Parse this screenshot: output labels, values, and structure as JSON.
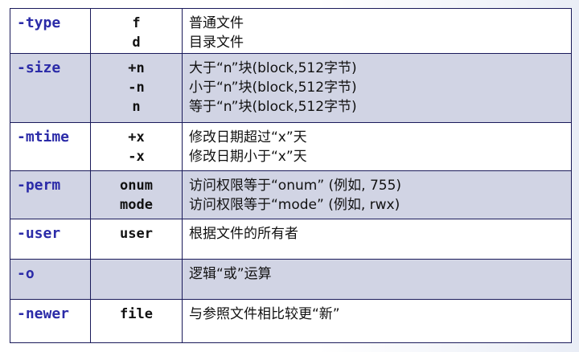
{
  "rows": [
    {
      "option": "-type",
      "args": [
        "f",
        "d"
      ],
      "desc": [
        "普通文件",
        "目录文件"
      ]
    },
    {
      "option": "-size",
      "args": [
        "+n",
        "-n",
        "n"
      ],
      "desc": [
        "大于“n”块(block,512字节)",
        "小于“n”块(block,512字节)",
        "等于“n”块(block,512字节)"
      ]
    },
    {
      "option": "-mtime",
      "args": [
        "+x",
        "-x"
      ],
      "desc": [
        "修改日期超过“x”天",
        "修改日期小于“x”天"
      ]
    },
    {
      "option": "-perm",
      "args": [
        "onum",
        "mode"
      ],
      "desc": [
        "访问权限等于“onum” (例如, 755)",
        "访问权限等于“mode” (例如, rwx)"
      ]
    },
    {
      "option": "-user",
      "args": [
        "user"
      ],
      "desc": [
        "根据文件的所有者"
      ]
    },
    {
      "option": "-o",
      "args": [],
      "desc": [
        "逻辑“或”运算"
      ]
    },
    {
      "option": "-newer",
      "args": [
        "file"
      ],
      "desc": [
        "与参照文件相比较更“新”"
      ]
    }
  ],
  "colors": {
    "option_text": "#2b2ba8",
    "shaded_row": "#d1d4e4",
    "border": "#1a1a5a"
  }
}
